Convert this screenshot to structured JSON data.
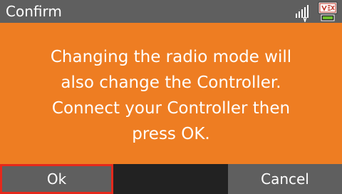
{
  "titlebar": {
    "title": "Confirm",
    "icons": [
      "signal-strength-icon",
      "vex-brain-status-icon"
    ],
    "battery_color": "#6fbf2f"
  },
  "message": {
    "lines": [
      "Changing the radio mode will",
      "also change the Controller.",
      "Connect your Controller then",
      "press OK."
    ],
    "background": "#ee7d22"
  },
  "buttons": {
    "ok_label": "Ok",
    "cancel_label": "Cancel",
    "selected_outline": "#e5291c"
  }
}
